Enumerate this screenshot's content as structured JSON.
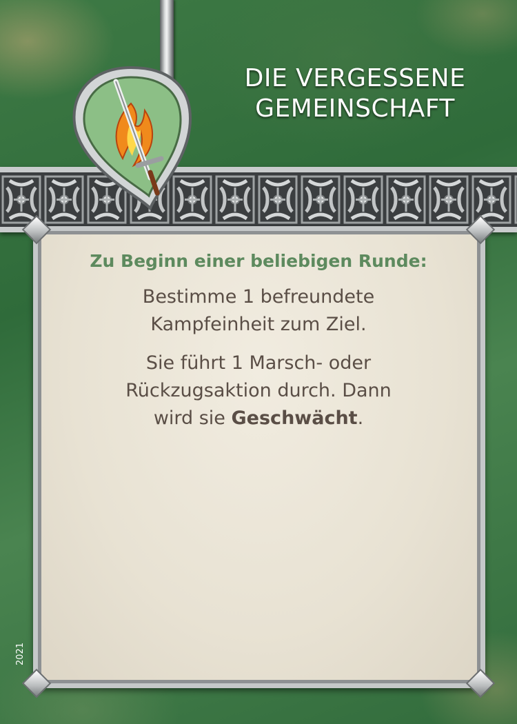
{
  "card": {
    "title_line1": "DIE VERGESSENE",
    "title_line2": "GEMEINSCHAFT",
    "emblem_icon": "flaming-sword-shield-icon",
    "trigger": "Zu Beginn einer beliebigen Runde:",
    "effect1_line1": "Bestimme 1 befreundete",
    "effect1_line2": "Kampfeinheit zum Ziel.",
    "effect2_line1": "Sie führt 1 Marsch- oder",
    "effect2_line2": "Rückzugsaktion durch. Dann",
    "effect2_line3_pre": "wird sie ",
    "effect2_keyword": "Geschwächt",
    "effect2_line3_post": ".",
    "year": "2021"
  },
  "colors": {
    "background_green": "#3e7a45",
    "trigger_green": "#5d8a5e",
    "body_text": "#5a4e46",
    "parchment": "#ece6d8",
    "metal": "#c9cccd"
  }
}
